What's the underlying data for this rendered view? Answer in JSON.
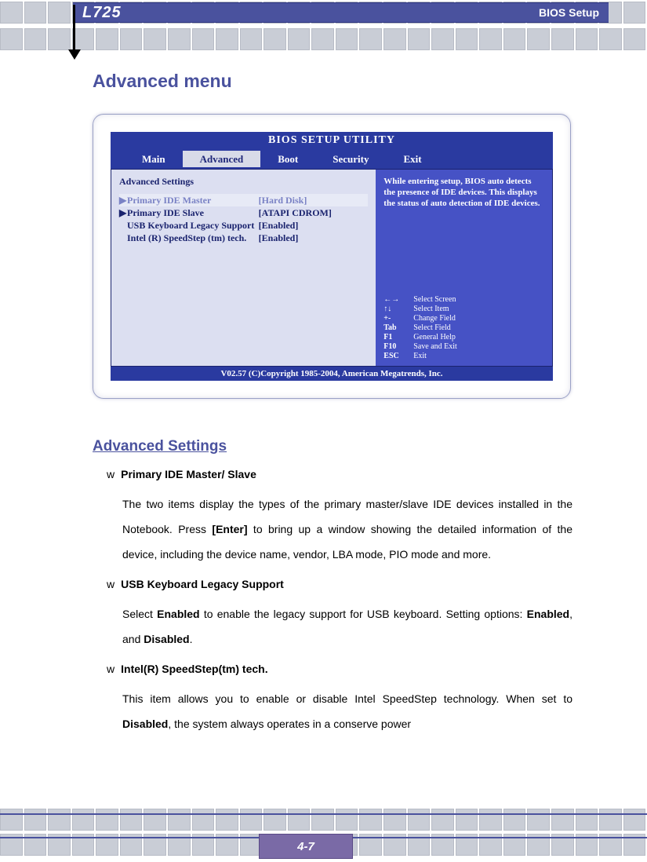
{
  "header": {
    "model": "L725",
    "section": "BIOS Setup"
  },
  "page_title": "Advanced menu",
  "bios": {
    "utility_title": "BIOS SETUP UTILITY",
    "tabs": [
      "Main",
      "Advanced",
      "Boot",
      "Security",
      "Exit"
    ],
    "active_tab": "Advanced",
    "left_heading": "Advanced Settings",
    "rows": [
      {
        "label": "Primary IDE Master",
        "value": "[Hard Disk]",
        "pointer": true,
        "selected": true
      },
      {
        "label": "Primary IDE Slave",
        "value": "[ATAPI CDROM]",
        "pointer": true,
        "selected": false
      },
      {
        "label": "USB Keyboard Legacy Support",
        "value": "[Enabled]",
        "pointer": false,
        "selected": false
      },
      {
        "label": "Intel (R) SpeedStep (tm) tech.",
        "value": "[Enabled]",
        "pointer": false,
        "selected": false
      }
    ],
    "help_text": "While entering setup, BIOS auto detects the presence of IDE devices.  This displays the status of auto detection of IDE devices.",
    "keys": [
      {
        "k": "←→",
        "d": "Select Screen"
      },
      {
        "k": "↑↓",
        "d": "Select Item"
      },
      {
        "k": "+-",
        "d": "Change Field"
      },
      {
        "k": "Tab",
        "d": "Select Field"
      },
      {
        "k": "F1",
        "d": "General Help"
      },
      {
        "k": "F10",
        "d": "Save and Exit"
      },
      {
        "k": "ESC",
        "d": "Exit"
      }
    ],
    "footer": "V02.57 (C)Copyright 1985-2004, American Megatrends, Inc."
  },
  "settings_title": "Advanced Settings",
  "items": [
    {
      "title": "Primary IDE Master/ Slave",
      "body_parts": [
        "The two items display the types of the primary master/slave IDE devices installed in the Notebook.   Press ",
        "[Enter]",
        " to bring up a window showing the detailed information of the device, including the device name, vendor, LBA mode, PIO mode and more."
      ]
    },
    {
      "title": "USB Keyboard Legacy Support",
      "body_parts": [
        "Select ",
        "Enabled",
        " to enable the legacy support for USB keyboard.   Setting options: ",
        "Enabled",
        ", and ",
        "Disabled",
        "."
      ]
    },
    {
      "title": "Intel(R) SpeedStep(tm) tech.",
      "body_parts": [
        "This item allows you to enable or disable Intel SpeedStep technology.  When set to ",
        "Disabled",
        ", the system always operates in a conserve power"
      ]
    }
  ],
  "page_number": "4-7"
}
